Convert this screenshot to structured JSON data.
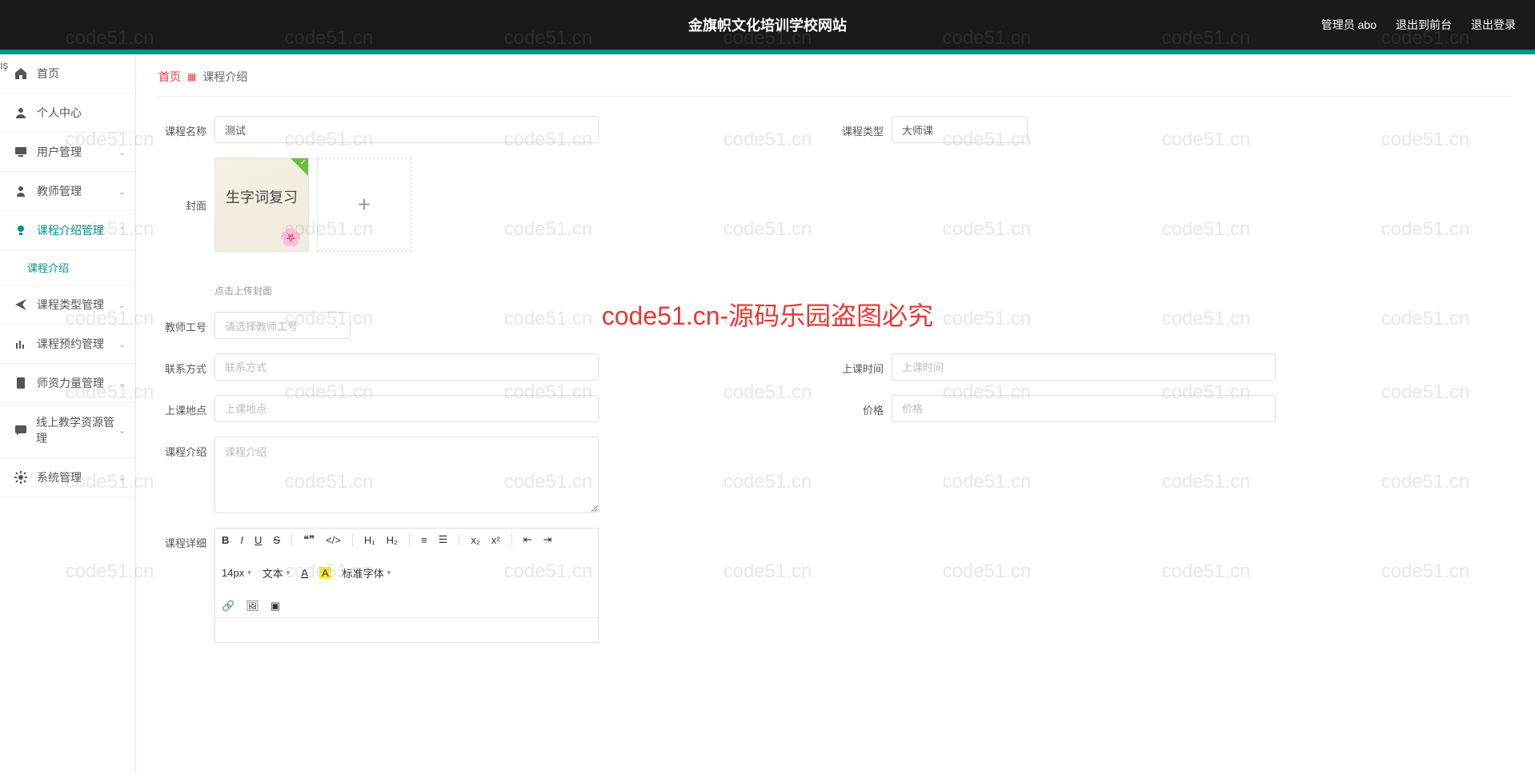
{
  "header": {
    "title": "金旗帜文化培训学校网站",
    "admin_label": "管理员 abo",
    "exit_front": "退出到前台",
    "logout": "退出登录"
  },
  "sidebar": {
    "items": [
      {
        "label": "首页",
        "icon": "home"
      },
      {
        "label": "个人中心",
        "icon": "user"
      },
      {
        "label": "用户管理",
        "icon": "monitor",
        "expandable": true
      },
      {
        "label": "教师管理",
        "icon": "person",
        "expandable": true
      },
      {
        "label": "课程介绍管理",
        "icon": "bulb",
        "expandable": true,
        "expanded": true,
        "sub": [
          {
            "label": "课程介绍"
          }
        ]
      },
      {
        "label": "课程类型管理",
        "icon": "send",
        "expandable": true
      },
      {
        "label": "课程预约管理",
        "icon": "bars",
        "expandable": true
      },
      {
        "label": "师资力量管理",
        "icon": "doc",
        "expandable": true
      },
      {
        "label": "线上教学资源管理",
        "icon": "chat",
        "expandable": true
      },
      {
        "label": "系统管理",
        "icon": "gear",
        "expandable": true
      }
    ]
  },
  "breadcrumb": {
    "home": "首页",
    "current": "课程介绍"
  },
  "form": {
    "course_name": {
      "label": "课程名称",
      "value": "测试"
    },
    "course_type": {
      "label": "课程类型",
      "value": "大师课"
    },
    "cover": {
      "label": "封面",
      "thumb_text": "生字词复习",
      "hint": "点击上传封面"
    },
    "teacher_id": {
      "label": "教师工号",
      "placeholder": "请选择教师工号"
    },
    "contact": {
      "label": "联系方式",
      "placeholder": "联系方式"
    },
    "class_time": {
      "label": "上课时间",
      "placeholder": "上课时间"
    },
    "class_place": {
      "label": "上课地点",
      "placeholder": "上课地点"
    },
    "price": {
      "label": "价格",
      "placeholder": "价格"
    },
    "course_intro": {
      "label": "课程介绍",
      "placeholder": "课程介绍"
    },
    "course_detail": {
      "label": "课程详细"
    }
  },
  "editor": {
    "font_size": "14px",
    "text_label": "文本",
    "font_label": "标准字体"
  },
  "watermark": {
    "small": "code51.cn",
    "center": "code51.cn-源码乐园盗图必究"
  }
}
